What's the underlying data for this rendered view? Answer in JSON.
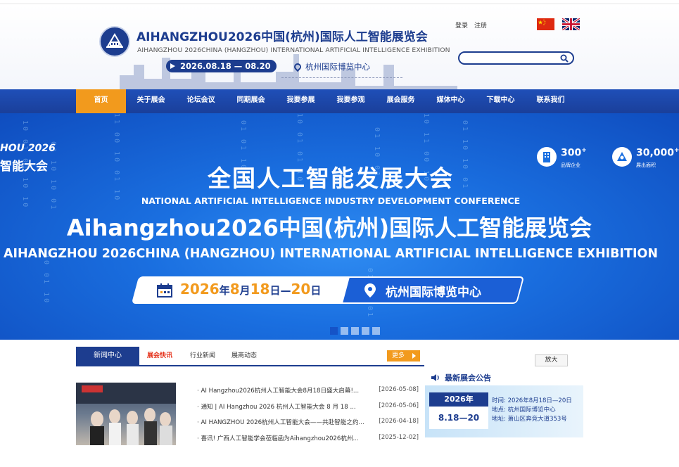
{
  "header": {
    "title_cn": "AIHANGZHOU2026中国(杭州)国际人工智能展览会",
    "title_en": "AIHANGZHOU 2026CHINA (HANGZHOU) INTERNATIONAL ARTIFICIAL INTELLIGENCE EXHIBITION",
    "date": "2026.08.18 — 08.20",
    "venue": "杭州国际博览中心",
    "login": "登录",
    "register": "注册",
    "search_placeholder": ""
  },
  "nav": {
    "items": [
      "首页",
      "关于展会",
      "论坛会议",
      "同期展会",
      "我要参展",
      "我要参观",
      "展会服务",
      "媒体中心",
      "下载中心",
      "联系我们"
    ],
    "active_index": 0
  },
  "banner": {
    "left_line1": "HOU 2026",
    "left_line2": "智能大会",
    "stat1_num": "300",
    "stat1_sup": "+",
    "stat1_label": "品牌企业",
    "stat2_num": "30,000",
    "stat2_sup": "+",
    "stat2_label": "展出面积",
    "title": "全国人工智能发展大会",
    "subtitle": "NATIONAL ARTIFICIAL INTELLIGENCE INDUSTRY DEVELOPMENT CONFERENCE",
    "big_title": "Aihangzhou2026中国(杭州)国际人工智能展览会",
    "en_title": "AIHANGZHOU 2026CHINA (HANGZHOU) INTERNATIONAL ARTIFICIAL INTELLIGENCE EXHIBITION",
    "date_year": "2026",
    "date_y_unit": "年",
    "date_month": "8",
    "date_m_unit": "月",
    "date_day1": "18",
    "date_d_unit": "日—",
    "date_day2": "20",
    "date_d2_unit": "日",
    "venue": "杭州国际博览中心",
    "slides": 5,
    "active_slide": 0
  },
  "news": {
    "section_title": "新闻中心",
    "tabs": [
      "展会快讯",
      "行业新闻",
      "展商动态"
    ],
    "active_tab": 0,
    "more": "更多",
    "items": [
      {
        "title": "· AI Hangzhou2026杭州人工智能大会8月18日盛大启幕!...",
        "date": "[2026-05-08]"
      },
      {
        "title": "· 通知 | AI Hangzhou 2026 杭州人工智能大会 8 月 18 ...",
        "date": "[2026-05-06]"
      },
      {
        "title": "· AI HANGZHOU 2026杭州人工智能大会——共赴智能之约...",
        "date": "[2026-04-18]"
      },
      {
        "title": "· 喜讯! 广西人工智能学会莅临函为Aihangzhou2026杭州...",
        "date": "[2025-12-02]"
      }
    ]
  },
  "notice": {
    "zoom": "放大",
    "title": "最新展会公告",
    "year": "2026年",
    "dates": "8.18—20",
    "time": "时间: 2026年8月18日—20日",
    "place": "地点: 杭州国际博览中心",
    "address": "地址: 萧山区奔竞大道353号"
  },
  "colors": {
    "brand_blue": "#1d3d8f",
    "nav_blue": "#1f4fb8",
    "accent_orange": "#f29a1d",
    "news_red": "#e5321b"
  }
}
